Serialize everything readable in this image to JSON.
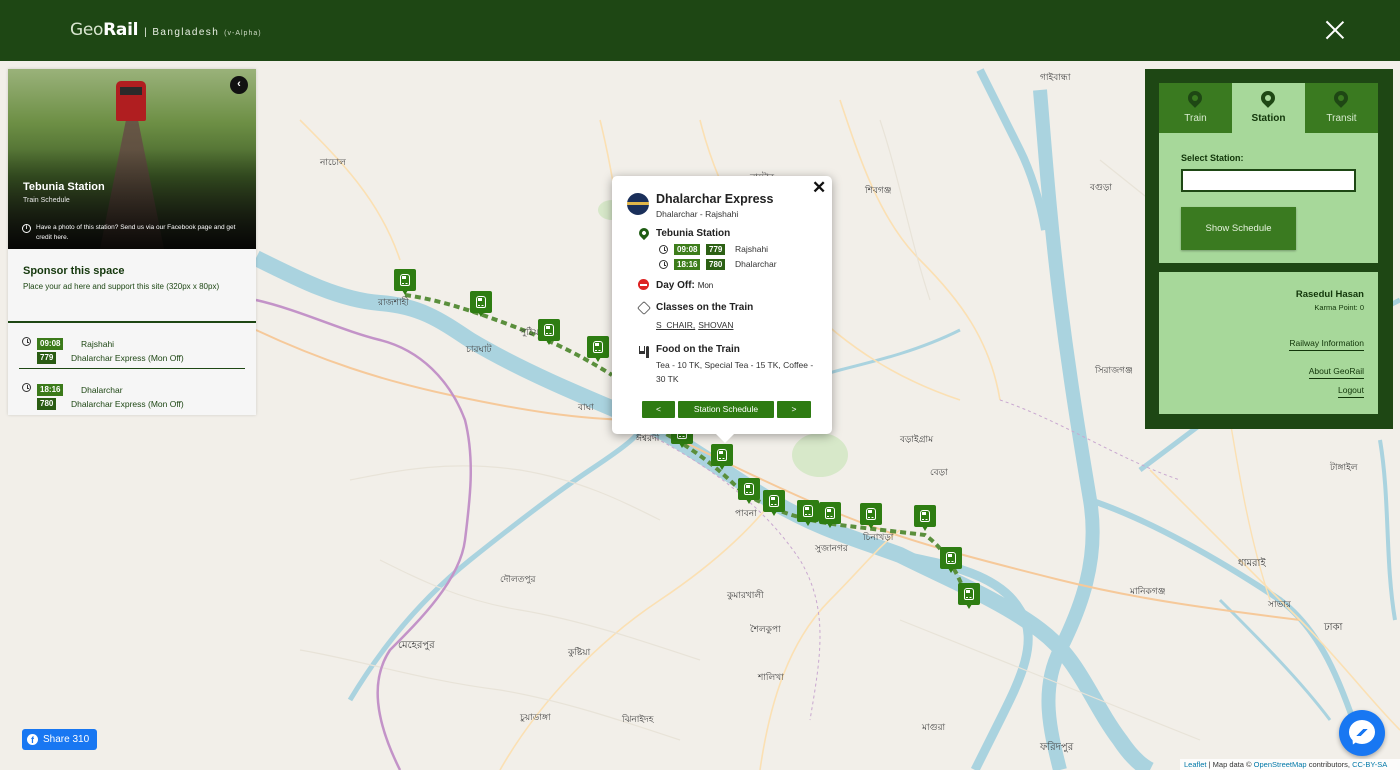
{
  "header": {
    "logo_geo": "Geo",
    "logo_rail": "Rail",
    "country": "| Bangladesh",
    "version": "(v-Alpha)",
    "close_icon": "close-icon"
  },
  "station_card": {
    "name": "Tebunia Station",
    "subtitle": "Train Schedule",
    "photo_note": "Have a photo of this station? Send us via our Facebook page and get credit here.",
    "back_icon": "chevron-left-icon"
  },
  "sponsor": {
    "title": "Sponsor this space",
    "text": "Place your ad here and support this site (320px x 80px)"
  },
  "schedule": [
    {
      "time": "09:08",
      "train_no": "779",
      "destination": "Rajshahi",
      "train": "Dhalarchar Express (Mon Off)"
    },
    {
      "time": "18:16",
      "train_no": "780",
      "destination": "Dhalarchar",
      "train": "Dhalarchar Express (Mon Off)"
    }
  ],
  "popup": {
    "title": "Dhalarchar Express",
    "route": "Dhalarchar - Rajshahi",
    "station": "Tebunia Station",
    "stops": [
      {
        "time": "09:08",
        "train_no": "779",
        "destination": "Rajshahi"
      },
      {
        "time": "18:16",
        "train_no": "780",
        "destination": "Dhalarchar"
      }
    ],
    "dayoff_label": "Day Off:",
    "dayoff_value": "Mon",
    "classes_title": "Classes on the Train",
    "classes": [
      "S_CHAIR,",
      "SHOVAN"
    ],
    "food_title": "Food on the Train",
    "food_text": "Tea - 10 TK, Special Tea - 15 TK, Coffee - 30 TK",
    "prev_label": "<",
    "schedule_label": "Station Schedule",
    "next_label": ">"
  },
  "tabs": [
    {
      "label": "Train",
      "active": false
    },
    {
      "label": "Station",
      "active": true
    },
    {
      "label": "Transit",
      "active": false
    }
  ],
  "station_search": {
    "label": "Select Station:",
    "value": "",
    "button": "Show Schedule"
  },
  "user": {
    "name": "Rasedul Hasan",
    "karma": "Karma Point: 0",
    "links": [
      "Railway Information",
      "About GeoRail",
      "Logout"
    ]
  },
  "share": {
    "label": "Share 310"
  },
  "attribution": {
    "leaflet": "Leaflet",
    "map_data": "| Map data ©",
    "osm": "OpenStreetMap",
    "contributors": "contributors,",
    "license": "CC-BY-SA"
  },
  "map_labels": [
    "রাজশাহী",
    "পুঠিয়া",
    "চারঘাট",
    "বাঘা",
    "নাটোর",
    "বড়াইগ্রাম",
    "ঈশ্বরদী",
    "পাবনা",
    "সুজানগর",
    "চিনাখড়া",
    "বেড়া",
    "মেহেরপুর",
    "কুষ্টিয়া",
    "ঝিনাইদহ",
    "মাগুরা",
    "ফরিদপুর",
    "সাভার",
    "ঢাকা",
    "ধামরাই",
    "সিরাজগঞ্জ",
    "বগুড়া",
    "গাইবান্ধা",
    "টাঙ্গাইল",
    "মানিকগঞ্জ",
    "শিবগঞ্জ",
    "নাচোল",
    "চুয়াডাঙ্গা",
    "কুমারখালী",
    "শৈলকুপা",
    "শালিখা",
    "দৌলতপুর"
  ],
  "colors": {
    "header": "#1e4714",
    "accent": "#2e7d12",
    "panel_light": "#a7d89a",
    "river": "#aad3df",
    "map_bg": "#f2efe9"
  }
}
